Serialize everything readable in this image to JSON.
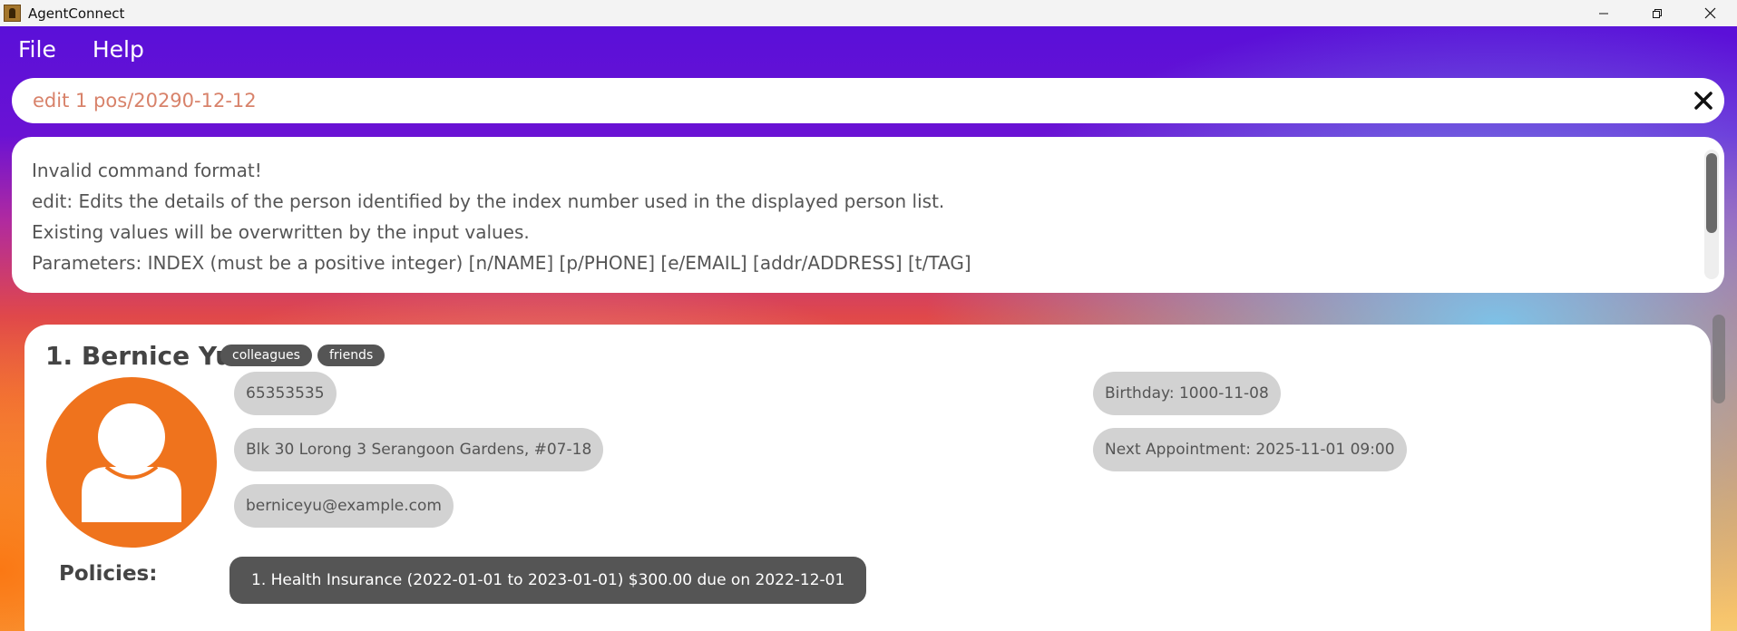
{
  "window": {
    "title": "AgentConnect"
  },
  "menu": {
    "file_label": "File",
    "help_label": "Help"
  },
  "command": {
    "value": "edit 1 pos/20290-12-12"
  },
  "result": {
    "lines": [
      "Invalid command format!",
      "edit: Edits the details of the person identified by the index number used in the displayed person list.",
      "Existing values will be overwritten by the input values.",
      "Parameters: INDEX (must be a positive integer) [n/NAME] [p/PHONE] [e/EMAIL] [addr/ADDRESS] [t/TAG]"
    ]
  },
  "person": {
    "title": "1. Bernice Yu",
    "tags": [
      "colleagues",
      "friends"
    ],
    "phone": "65353535",
    "address": "Blk 30 Lorong 3 Serangoon Gardens, #07-18",
    "email": "berniceyu@example.com",
    "birthday": "Birthday: 1000-11-08",
    "next_appointment": "Next Appointment: 2025-11-01 09:00",
    "policies_label": "Policies:",
    "policies": [
      "1. Health Insurance (2022-01-01 to 2023-01-01) $300.00 due on 2022-12-01"
    ]
  },
  "icons": {
    "app": "app-icon",
    "minimize": "minimize-icon",
    "maximize": "restore-icon",
    "close": "close-icon",
    "clear": "clear-icon",
    "avatar": "person-avatar-icon"
  },
  "colors": {
    "avatar_bg": "#ef731d",
    "tag_bg": "#555555",
    "field_bg": "#d2d2d2",
    "command_text": "#d8826a"
  }
}
